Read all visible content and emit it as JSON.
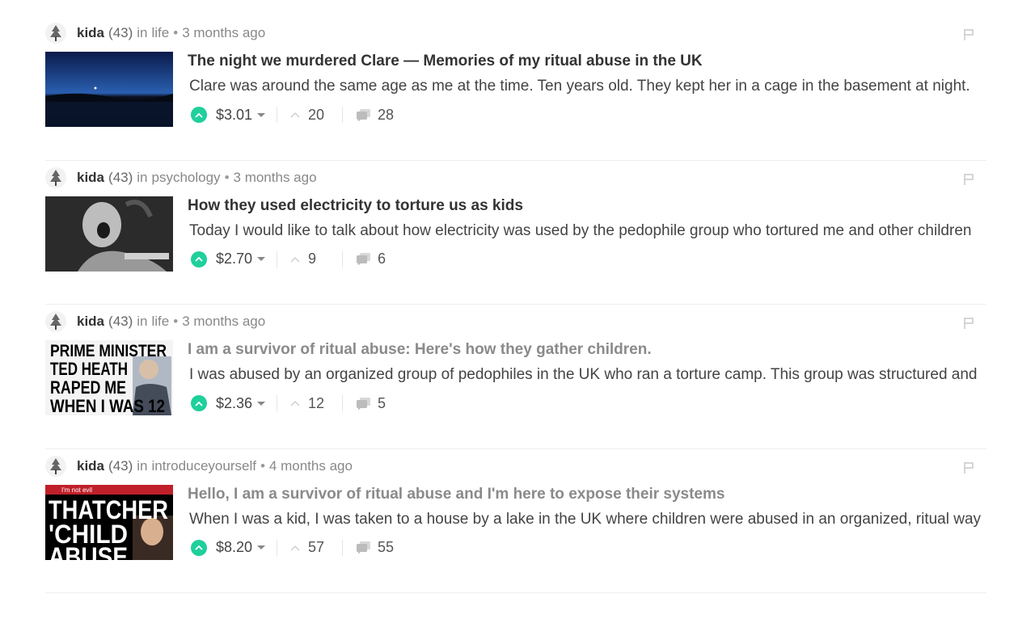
{
  "posts": [
    {
      "author": "kida",
      "reputation": "(43)",
      "in_label": "in",
      "category": "life",
      "time": "3 months ago",
      "title": "The night we murdered Clare — Memories of my ritual abuse in the UK",
      "title_read": false,
      "body": "Clare was around the same age as me at the time. Ten years old. They kept her in a cage in the basement at night.",
      "payout": "$3.01",
      "votes": "20",
      "comments": "28",
      "thumb_icon": "night-lake-image"
    },
    {
      "author": "kida",
      "reputation": "(43)",
      "in_label": "in",
      "category": "psychology",
      "time": "3 months ago",
      "title": "How they used electricity to torture us as kids",
      "title_read": false,
      "body": "Today I would like to talk about how electricity was used by the pedophile group who tortured me and other children",
      "payout": "$2.70",
      "votes": "9",
      "comments": "6",
      "thumb_icon": "screaming-child-image"
    },
    {
      "author": "kida",
      "reputation": "(43)",
      "in_label": "in",
      "category": "life",
      "time": "3 months ago",
      "title": "I am a survivor of ritual abuse: Here's how they gather children.",
      "title_read": true,
      "body": "I was abused by an organized group of pedophiles in the UK who ran a torture camp. This group was structured and",
      "payout": "$2.36",
      "votes": "12",
      "comments": "5",
      "thumb_icon": "newspaper-headline-image",
      "thumb_text": [
        "PRIME MINISTER",
        "TED HEATH",
        "RAPED ME",
        "WHEN I WAS 12"
      ]
    },
    {
      "author": "kida",
      "reputation": "(43)",
      "in_label": "in",
      "category": "introduceyourself",
      "time": "4 months ago",
      "title": "Hello, I am a survivor of ritual abuse and I'm here to expose their systems",
      "title_read": true,
      "body": "When I was a kid, I was taken to a house by a lake in the UK where children were abused in an organized, ritual way",
      "payout": "$8.20",
      "votes": "57",
      "comments": "55",
      "thumb_icon": "newspaper-headline-image",
      "thumb_text": [
        "I'm not evil",
        "THATCHER",
        "'CHILD",
        "ABUSE"
      ]
    }
  ],
  "colors": {
    "upvote": "#1fcf9c",
    "title": "#333333",
    "title_read": "#8a8a8a",
    "muted": "#888888",
    "divider": "#eeeeee"
  }
}
